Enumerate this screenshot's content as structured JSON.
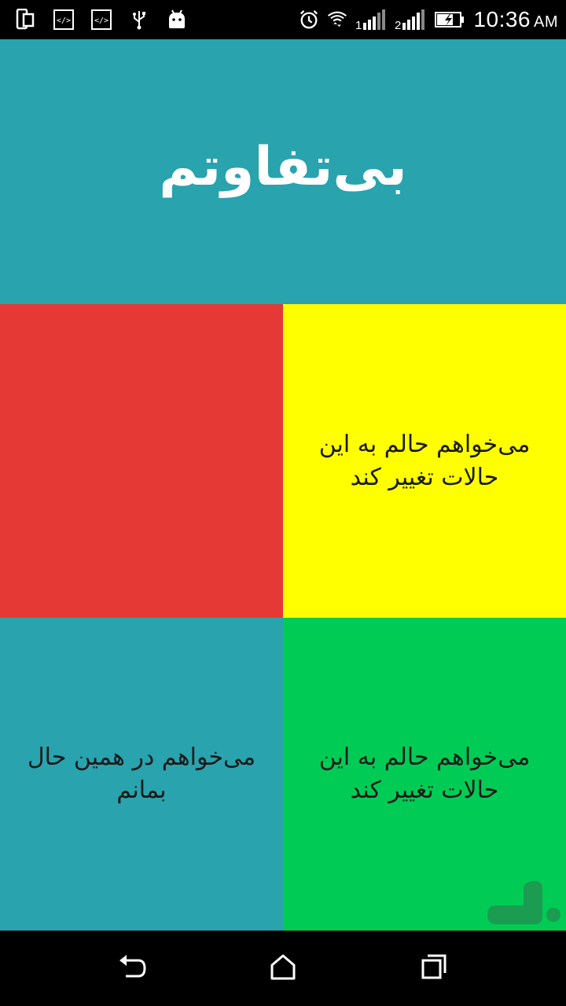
{
  "status_bar": {
    "time": "10:36",
    "ampm": "AM",
    "left_icons": [
      "phone-icon",
      "code-icon",
      "code-icon",
      "usb-icon",
      "android-icon"
    ],
    "right_icons": [
      "alarm-icon",
      "wifi-icon",
      "signal-1-icon",
      "signal-2-icon",
      "battery-icon"
    ],
    "signal_labels": [
      "1",
      "2"
    ]
  },
  "header": {
    "title": "بی‌تفاوتم",
    "bg_color": "#29a3ae"
  },
  "tiles": [
    {
      "text": "می‌خواهم حالم به این حالات تغییر کند",
      "color": "#ffff00"
    },
    {
      "text": "",
      "color": "#e53935"
    },
    {
      "text": "می‌خواهم در همین حال بمانم",
      "color": "#29a3ae"
    },
    {
      "text": "می‌خواهم حالم به این حالات تغییر کند",
      "color": "#00cc55"
    }
  ],
  "nav": {
    "buttons": [
      "back-icon",
      "home-icon",
      "recents-icon"
    ]
  },
  "watermark": {
    "icon": "store-logo-icon"
  }
}
